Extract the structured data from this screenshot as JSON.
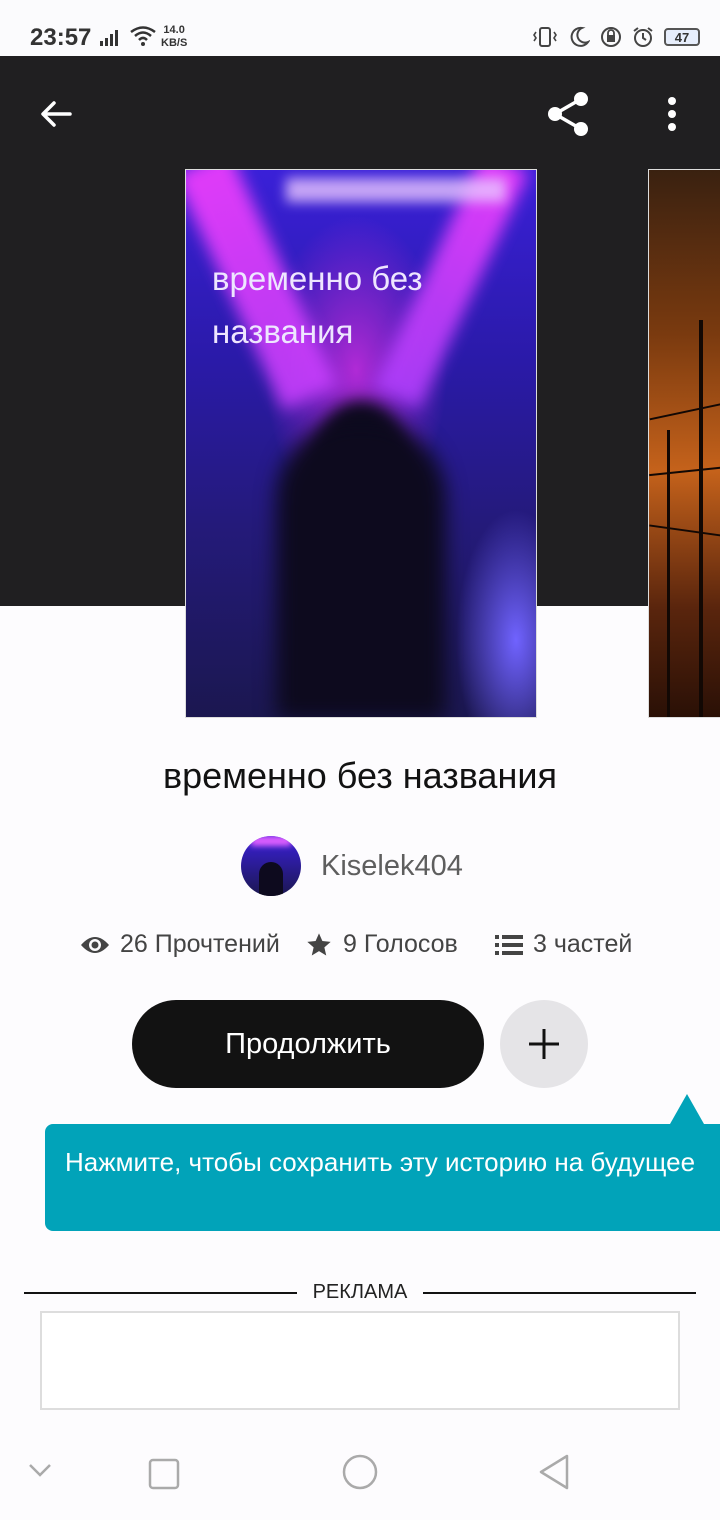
{
  "status_bar": {
    "time": "23:57",
    "speed_value": "14.0",
    "speed_unit": "KB/S",
    "battery": "47"
  },
  "header": {
    "back_icon": "arrow-left-icon",
    "share_icon": "share-icon",
    "more_icon": "more-vertical-icon"
  },
  "cover": {
    "text": "временно без названия"
  },
  "story": {
    "title": "временно без названия",
    "author": "Kiselek404",
    "reads": "26 Прочтений",
    "votes": "9 Голосов",
    "parts": "3 частей"
  },
  "actions": {
    "continue_label": "Продолжить",
    "add_icon": "plus-icon"
  },
  "tooltip": {
    "text": "Нажмите, чтобы сохранить эту историю на будущее"
  },
  "ad": {
    "label": "РЕКЛАМА"
  },
  "colors": {
    "header_bg": "#201f21",
    "accent_teal": "#01a3b9",
    "button_dark": "#121212"
  }
}
